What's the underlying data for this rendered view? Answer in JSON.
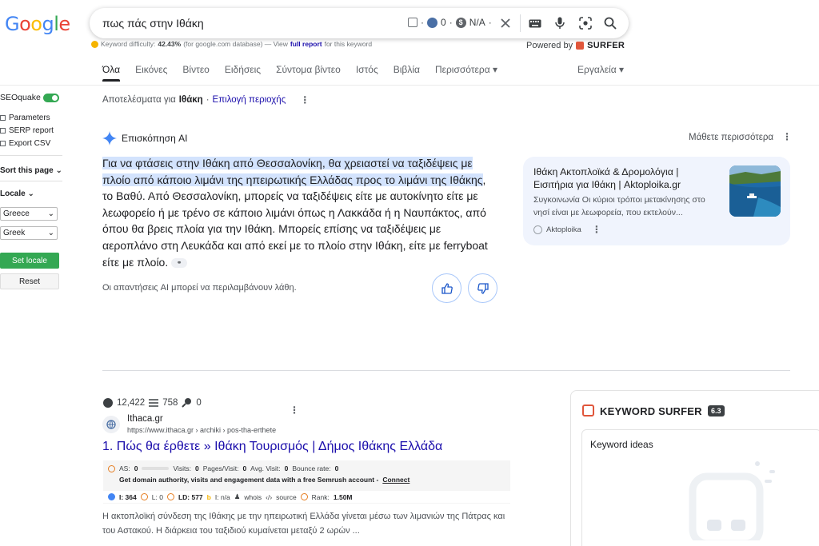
{
  "logo": {
    "letters": [
      "G",
      "o",
      "o",
      "g",
      "l",
      "e"
    ],
    "colors": [
      "#4285f4",
      "#ea4335",
      "#fbbc05",
      "#4285f4",
      "#34a853",
      "#ea4335"
    ]
  },
  "search": {
    "query": "πως πάς στην Ιθάκη",
    "mini_sep1": "·",
    "globe_value": "0",
    "mini_sep2": "·",
    "dollar_value": "N/A",
    "mini_sep3": "·"
  },
  "keyword_line": {
    "label": "Keyword difficulty:",
    "value": "42.43%",
    "source": "(for google.com database) — View",
    "link": "full report",
    "suffix": "for this keyword"
  },
  "powered": {
    "label": "Powered by",
    "brand": "SURFER"
  },
  "tabs": [
    "Όλα",
    "Εικόνες",
    "Βίντεο",
    "Ειδήσεις",
    "Σύντομα βίντεο",
    "Ιστός",
    "Βιβλία",
    "Περισσότερα ▾"
  ],
  "tools": "Εργαλεία ▾",
  "seoquake": {
    "title": "SEOquake",
    "links": [
      "Parameters",
      "SERP report",
      "Export CSV"
    ],
    "sort": "Sort this page ⌄",
    "locale": "Locale ⌄",
    "country": "Greece",
    "language": "Greek",
    "set_locale": "Set locale",
    "reset": "Reset"
  },
  "results_for": {
    "prefix": "Αποτελέσματα για",
    "place": "Ιθάκη",
    "sep": "·",
    "link": "Επιλογή περιοχής"
  },
  "ai_overview": {
    "header": "Επισκόπηση AI",
    "learn_more": "Μάθετε περισσότερα",
    "highlighted": "Για να φτάσεις στην Ιθάκη από Θεσσαλονίκη, θα χρειαστεί να ταξιδέψεις με πλοίο από κάποιο λιμάνι της ηπειρωτικής Ελλάδας προς το λιμάνι της Ιθάκης",
    "rest": ", το Βαθύ. Από Θεσσαλονίκη, μπορείς να ταξιδέψεις είτε με αυτοκίνητο είτε με λεωφορείο ή με τρένο σε κάποιο λιμάνι όπως η Λακκάδα ή η Ναυπάκτος, από όπου θα βρεις πλοία για την Ιθάκη. Μπορείς επίσης να ταξιδέψεις με αεροπλάνο στη Λευκάδα και από εκεί με το πλοίο στην Ιθάκη, είτε με ferryboat είτε με πλοίο.",
    "disclaimer": "Οι απαντήσεις AI μπορεί να περιλαμβάνουν λάθη.",
    "source_card": {
      "title": "Ιθάκη Ακτοπλοϊκά & Δρομολόγια | Εισιτήρια για Ιθάκη | Aktoploika.gr",
      "desc": "Συγκοινωνία Οι κύριοι τρόποι μετακίνησης στο νησί είναι με λεωφορεία, που εκτελούν...",
      "site": "Aktoploika"
    }
  },
  "result1": {
    "stats": {
      "a": "12,422",
      "b": "758",
      "c": "0"
    },
    "site_name": "Ithaca.gr",
    "url": "https://www.ithaca.gr › archiki › pos-tha-erthete",
    "title": "1. Πώς θα έρθετε » Ιθάκη Τουρισμός | Δήμος Ιθάκης Ελλάδα",
    "semrush": {
      "as_label": "AS:",
      "as_value": "0",
      "visits_label": "Visits:",
      "visits": "0",
      "pages_label": "Pages/Visit:",
      "pages": "0",
      "avg_label": "Avg. Visit:",
      "avg": "0",
      "bounce_label": "Bounce rate:",
      "bounce": "0",
      "cta": "Get domain authority, visits and engagement data with a free Semrush account -",
      "connect": "Connect",
      "i": "I: 364",
      "l": "L: 0",
      "ld": "LD: 577",
      "b": "I: n/a",
      "whois": "whois",
      "source": "source",
      "rank_label": "Rank:",
      "rank": "1.50M"
    },
    "snippet": "Η ακτοπλοϊκή σύνδεση της Ιθάκης με την ηπειρωτική Ελλάδα γίνεται μέσω των λιμανιών της Πάτρας και του Αστακού. Η διάρκεια του ταξιδιού κυμαίνεται μεταξύ 2 ωρών ..."
  },
  "keyword_surfer": {
    "title": "KEYWORD SURFER",
    "version": "6.3",
    "ideas": "Keyword ideas"
  }
}
